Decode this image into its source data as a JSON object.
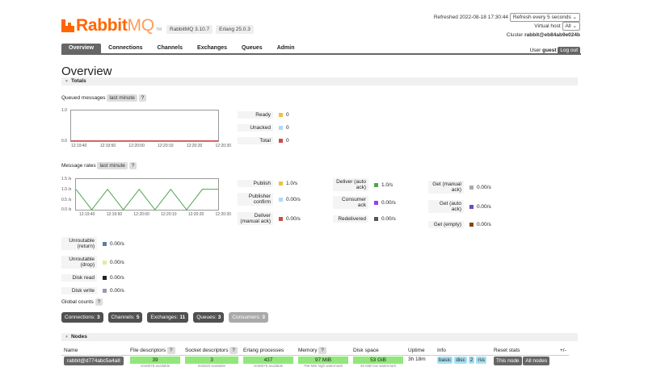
{
  "brand": {
    "rabbit": "Rabbit",
    "mq": "MQ",
    "tm": "TM",
    "rabbitmq_version": "RabbitMQ 3.10.7",
    "erlang_version": "Erlang 25.0.3"
  },
  "header": {
    "refreshed_label": "Refreshed 2022-08-18 17:30:44",
    "refresh_select": "Refresh every 5 seconds",
    "vhost_label": "Virtual host",
    "vhost_value": "All",
    "cluster_label": "Cluster",
    "cluster_name": "rabbit@eb84ab9e024b",
    "user_label": "User",
    "user_name": "guest",
    "logout": "Log out"
  },
  "nav": [
    "Overview",
    "Connections",
    "Channels",
    "Exchanges",
    "Queues",
    "Admin"
  ],
  "page_title": "Overview",
  "totals": {
    "title": "Totals",
    "queued": {
      "label": "Queued messages",
      "range": "last minute",
      "help": "?",
      "y_ticks": [
        "1.0",
        "0.0"
      ],
      "x_ticks": [
        "12:19:40",
        "12:19:50",
        "12:20:00",
        "12:20:10",
        "12:20:20",
        "12:20:30"
      ],
      "legend": [
        {
          "label": "Ready",
          "value": "0",
          "color": "#edc240"
        },
        {
          "label": "Unacked",
          "value": "0",
          "color": "#afd8f8"
        },
        {
          "label": "Total",
          "value": "0",
          "color": "#cb4b4b"
        }
      ]
    },
    "rates": {
      "label": "Message rates",
      "range": "last minute",
      "help": "?",
      "y_ticks": [
        "1.5 /s",
        "1.0 /s",
        "0.5 /s",
        "0.0 /s"
      ],
      "x_ticks": [
        "12:19:40",
        "12:19:50",
        "12:20:00",
        "12:20:10",
        "12:20:20",
        "12:20:30"
      ],
      "series_values": [
        1,
        0,
        1,
        0,
        1,
        0,
        1,
        0,
        1,
        1
      ],
      "col1": [
        {
          "label": "Publish",
          "value": "1.0/s",
          "color": "#edc240"
        },
        {
          "label": "Publisher confirm",
          "value": "0.00/s",
          "color": "#afd8f8"
        },
        {
          "label": "Deliver (manual ack)",
          "value": "0.00/s",
          "color": "#cb4b4b"
        }
      ],
      "col2": [
        {
          "label": "Deliver (auto ack)",
          "value": "1.0/s",
          "color": "#4da74d"
        },
        {
          "label": "Consumer ack",
          "value": "0.00/s",
          "color": "#9440ed"
        },
        {
          "label": "Redelivered",
          "value": "0.00/s",
          "color": "#555555"
        }
      ],
      "col3": [
        {
          "label": "Get (manual ack)",
          "value": "0.00/s",
          "color": "#aaaaaa"
        },
        {
          "label": "Get (auto ack)",
          "value": "0.00/s",
          "color": "#6d4dbd"
        },
        {
          "label": "Get (empty)",
          "value": "0.00/s",
          "color": "#8b4513"
        }
      ],
      "extra": [
        {
          "label": "Unroutable (return)",
          "value": "0.00/s",
          "color": "#5a7fa0"
        },
        {
          "label": "Unroutable (drop)",
          "value": "0.00/s",
          "color": "#e8e89e"
        },
        {
          "label": "Disk read",
          "value": "0.00/s",
          "color": "#222222"
        },
        {
          "label": "Disk write",
          "value": "0.00/s",
          "color": "#a393b4"
        }
      ]
    }
  },
  "global_counts": {
    "label": "Global counts",
    "help": "?",
    "items": [
      {
        "label": "Connections:",
        "value": "3"
      },
      {
        "label": "Channels:",
        "value": "5"
      },
      {
        "label": "Exchanges:",
        "value": "11"
      },
      {
        "label": "Queues:",
        "value": "3"
      },
      {
        "label": "Consumers:",
        "value": "3"
      }
    ]
  },
  "nodes": {
    "title": "Nodes",
    "plusminus": "+/-",
    "headers": [
      "Name",
      "File descriptors",
      "Socket descriptors",
      "Erlang processes",
      "Memory",
      "Disk space",
      "Uptime",
      "Info",
      "Reset stats"
    ],
    "row": {
      "name": "rabbit@d774abc5a4a8",
      "fd": "39",
      "fd_sub": "1048576 available",
      "sd": "3",
      "sd_sub": "943629 available",
      "ep": "437",
      "ep_sub": "1048576 available",
      "mem": "97 MiB",
      "mem_sub": "795 MiB high watermark",
      "disk": "53 GiB",
      "disk_sub": "48 MiB low watermark",
      "uptime": "3h 18m",
      "info": [
        "basic",
        "disc",
        "2",
        "rss"
      ],
      "reset_node": "This node",
      "reset_all": "All nodes"
    }
  }
}
